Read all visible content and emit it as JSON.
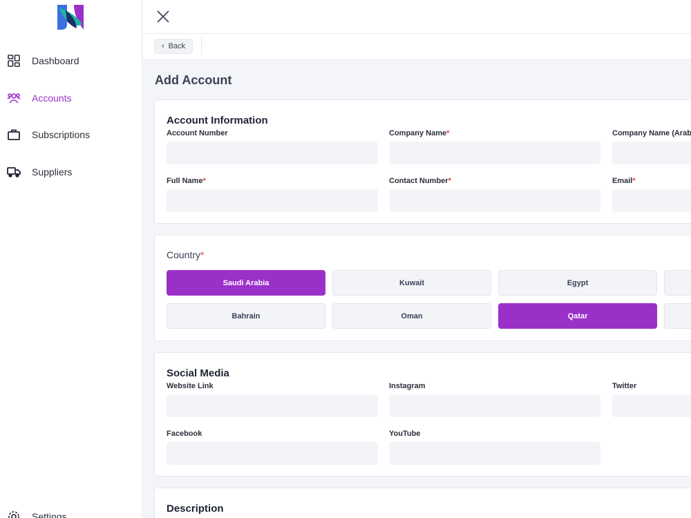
{
  "sidebar": {
    "items": [
      {
        "label": "Dashboard",
        "icon": "dashboard-icon"
      },
      {
        "label": "Accounts",
        "icon": "accounts-icon",
        "active": true
      },
      {
        "label": "Subscriptions",
        "icon": "briefcase-icon"
      },
      {
        "label": "Suppliers",
        "icon": "truck-icon"
      }
    ],
    "settings_label": "Settings"
  },
  "toolbar": {
    "back_label": "Back"
  },
  "page_title": "Add Account",
  "account_info": {
    "title": "Account Information",
    "fields": [
      {
        "label": "Account Number",
        "required": false,
        "value": ""
      },
      {
        "label": "Company Name",
        "required": true,
        "value": ""
      },
      {
        "label": "Company Name (Arabic)",
        "required": false,
        "value": ""
      },
      {
        "label": "Full Name",
        "required": true,
        "value": ""
      },
      {
        "label": "Contact Number",
        "required": true,
        "value": ""
      },
      {
        "label": "Email",
        "required": true,
        "value": ""
      }
    ]
  },
  "country": {
    "title": "Country",
    "required_mark": "*",
    "options": [
      "Saudi Arabia",
      "Kuwait",
      "Egypt",
      "",
      "Bahrain",
      "Oman",
      "Qatar",
      ""
    ],
    "selected": [
      "Saudi Arabia",
      "Qatar"
    ]
  },
  "social_media": {
    "title": "Social Media",
    "fields": [
      {
        "label": "Website Link",
        "value": ""
      },
      {
        "label": "Instagram",
        "value": ""
      },
      {
        "label": "Twitter",
        "value": ""
      },
      {
        "label": "Facebook",
        "value": ""
      },
      {
        "label": "YouTube",
        "value": ""
      }
    ]
  },
  "description": {
    "title": "Description"
  },
  "colors": {
    "accent": "#9b30c9",
    "required": "#d9463a"
  }
}
